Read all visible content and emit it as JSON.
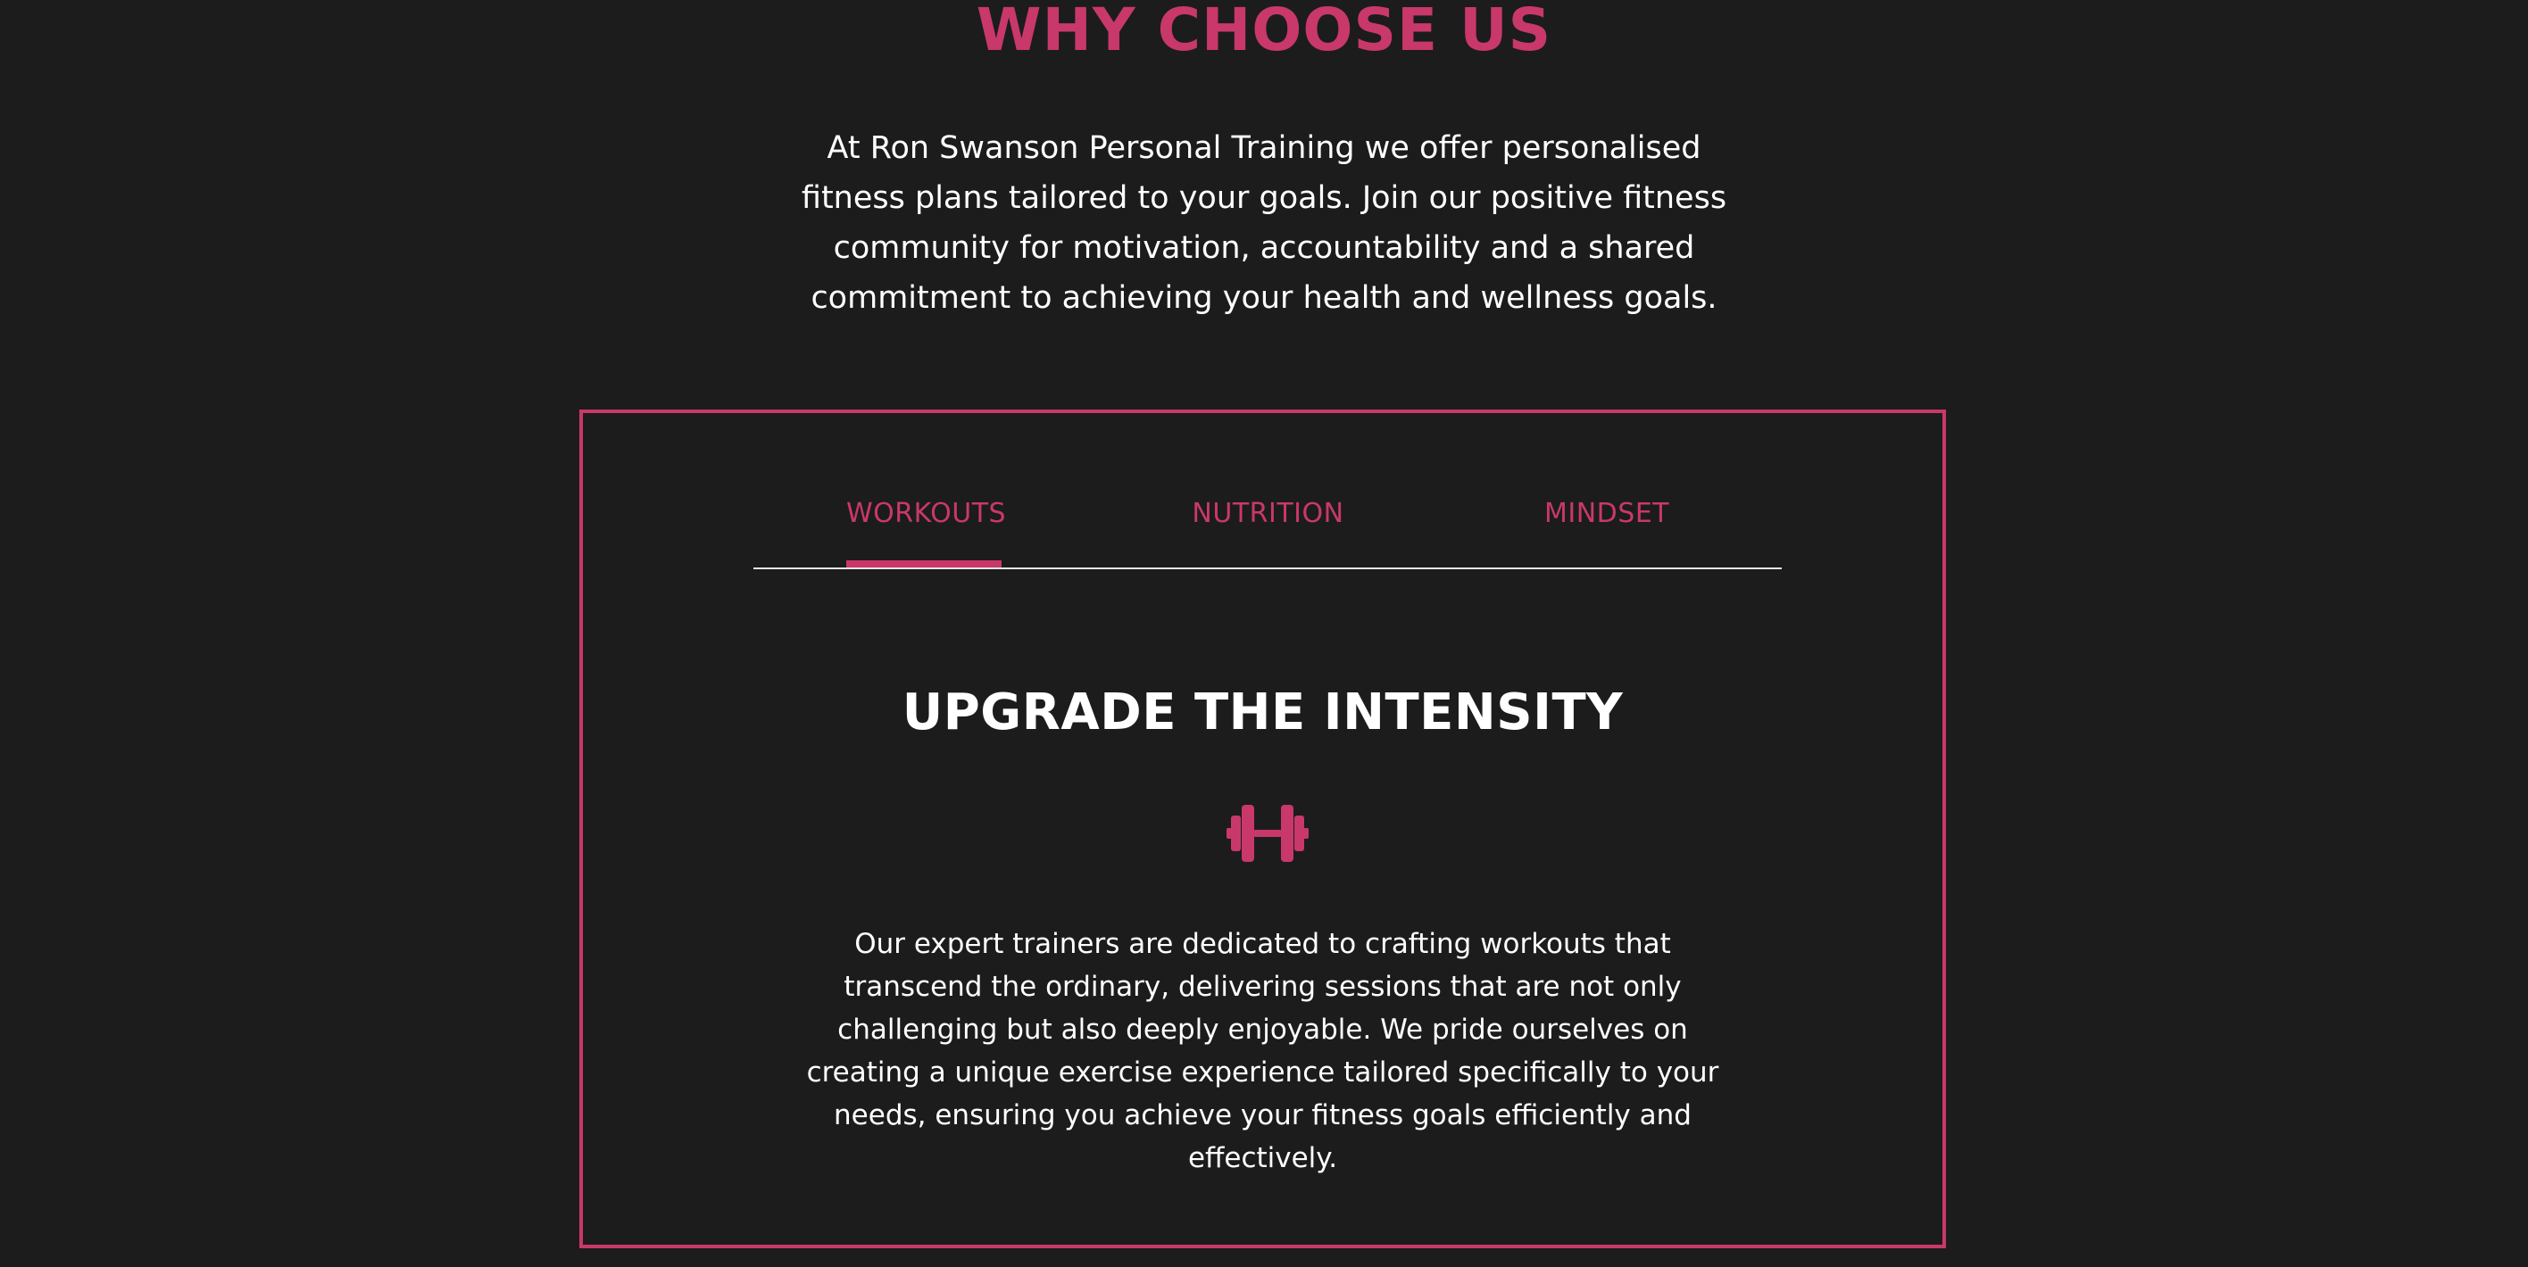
{
  "section": {
    "title": "WHY CHOOSE US",
    "intro": "At Ron Swanson Personal Training we offer personalised fitness plans tailored to your goals. Join our positive fitness community for motivation, accountability and a shared commitment to achieving your health and wellness goals."
  },
  "tabs": [
    {
      "label": "WORKOUTS",
      "active": true
    },
    {
      "label": "NUTRITION",
      "active": false
    },
    {
      "label": "MINDSET",
      "active": false
    }
  ],
  "panel": {
    "heading": "UPGRADE THE INTENSITY",
    "icon": "dumbbell-icon",
    "text": "Our expert trainers are dedicated to crafting workouts that transcend the ordinary, delivering sessions that are not only challenging but also deeply enjoyable. We pride ourselves on creating a unique exercise experience tailored specifically to your needs, ensuring you achieve your fitness goals efficiently and effectively."
  },
  "colors": {
    "accent": "#c9386a",
    "background": "#1c1c1d",
    "text": "#ffffff"
  }
}
